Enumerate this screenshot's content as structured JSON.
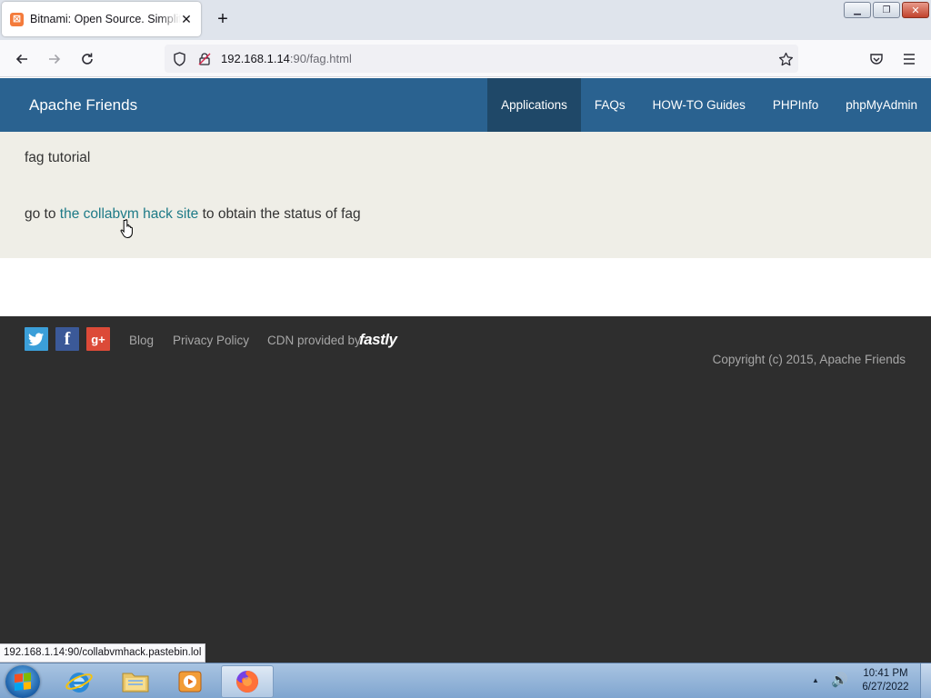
{
  "browser": {
    "tab": {
      "title": "Bitnami: Open Source. Simplified",
      "favicon": "xampp-icon"
    },
    "url": {
      "host": "192.168.1.14",
      "rest": ":90/fag.html"
    },
    "status_url": "192.168.1.14:90/collabvmhack.pastebin.lol"
  },
  "site": {
    "brand": "Apache Friends",
    "menu": [
      {
        "label": "Applications",
        "active": true
      },
      {
        "label": "FAQs",
        "active": false
      },
      {
        "label": "HOW-TO Guides",
        "active": false
      },
      {
        "label": "PHPInfo",
        "active": false
      },
      {
        "label": "phpMyAdmin",
        "active": false
      }
    ],
    "content": {
      "title": "fag tutorial",
      "line_prefix": "go to ",
      "link_text": "the collabvm hack site",
      "line_suffix": " to obtain the status of fag"
    },
    "footer": {
      "social": [
        "twitter-icon",
        "facebook-icon",
        "google-plus-icon"
      ],
      "links": [
        "Blog",
        "Privacy Policy"
      ],
      "cdn_label": "CDN provided by",
      "cdn_brand": "fastly",
      "copyright": "Copyright (c) 2015, Apache Friends"
    }
  },
  "taskbar": {
    "apps": [
      "internet-explorer-icon",
      "file-explorer-icon",
      "media-player-icon",
      "firefox-icon"
    ],
    "active_app": "firefox-icon",
    "time": "10:41 PM",
    "date": "6/27/2022"
  },
  "colors": {
    "header": "#2a6290",
    "header_active": "#1f4868",
    "content_bg": "#efeee7",
    "link": "#1d7a87",
    "footer_bg": "#2e2e2e"
  }
}
